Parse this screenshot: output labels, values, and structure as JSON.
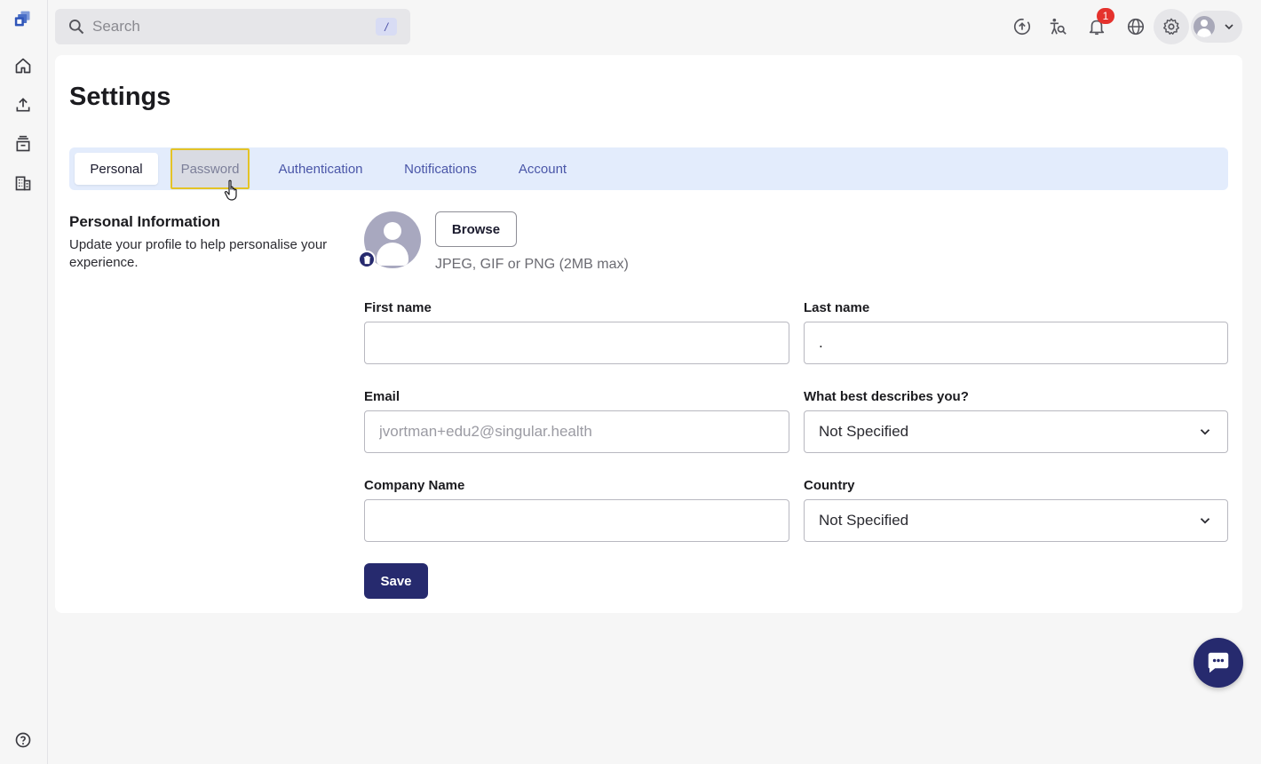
{
  "search": {
    "placeholder": "Search",
    "shortcut": "/"
  },
  "notifications": {
    "count": "1"
  },
  "page": {
    "title": "Settings"
  },
  "tabs": [
    {
      "label": "Personal",
      "state": "active"
    },
    {
      "label": "Password",
      "state": "hover"
    },
    {
      "label": "Authentication",
      "state": ""
    },
    {
      "label": "Notifications",
      "state": ""
    },
    {
      "label": "Account",
      "state": ""
    }
  ],
  "personal": {
    "title": "Personal Information",
    "description": "Update your profile to help personalise your experience.",
    "browse_label": "Browse",
    "file_hint": "JPEG, GIF or PNG (2MB max)"
  },
  "form": {
    "first_name": {
      "label": "First name",
      "value": ""
    },
    "last_name": {
      "label": "Last name",
      "value": "."
    },
    "email": {
      "label": "Email",
      "value": "jvortman+edu2@singular.health"
    },
    "describes": {
      "label": "What best describes you?",
      "value": "Not Specified"
    },
    "company": {
      "label": "Company Name",
      "value": ""
    },
    "country": {
      "label": "Country",
      "value": "Not Specified"
    },
    "save_label": "Save"
  },
  "icons": {
    "sidebar": [
      "logo-icon",
      "home-icon",
      "upload-icon",
      "archive-icon",
      "organization-icon",
      "help-icon"
    ],
    "topbar": [
      "upload-cloud-icon",
      "accessibility-icon",
      "bell-icon",
      "globe-icon",
      "gear-icon",
      "user-icon"
    ]
  },
  "colors": {
    "primary": "#262a6e",
    "tab_bg": "#e3ecfc",
    "badge": "#e5322d",
    "highlight": "#e4c325"
  }
}
